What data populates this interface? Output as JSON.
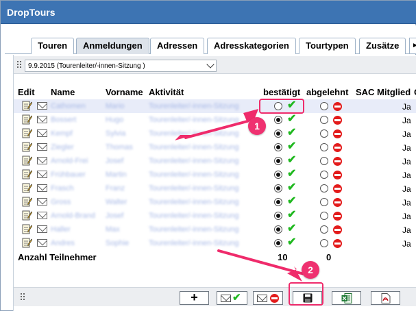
{
  "window": {
    "title": "DropTours"
  },
  "tabs": [
    {
      "label": "Touren"
    },
    {
      "label": "Anmeldungen",
      "active": true
    },
    {
      "label": "Adressen"
    },
    {
      "label": "Adresskategorien"
    },
    {
      "label": "Tourtypen"
    },
    {
      "label": "Zusätze"
    }
  ],
  "filter": {
    "selected": "9.9.2015 (Tourenleiter/-innen-Sitzung )"
  },
  "columns": {
    "edit": "Edit",
    "name": "Name",
    "vorname": "Vorname",
    "aktivitaet": "Aktivität",
    "bestaetigt": "bestätigt",
    "abgelehnt": "abgelehnt",
    "sac": "SAC Mitglied",
    "extra": "G"
  },
  "rows": [
    {
      "name": "Cathomen",
      "vorname": "Mario",
      "aktivitaet": "Tourenleiter/-innen-Sitzung",
      "bestaetigt": false,
      "sac": "Ja",
      "selected": true
    },
    {
      "name": "Bossert",
      "vorname": "Hugo",
      "aktivitaet": "Tourenleiter/-innen-Sitzung",
      "bestaetigt": true,
      "sac": "Ja"
    },
    {
      "name": "Kempf",
      "vorname": "Sylvia",
      "aktivitaet": "Tourenleiter/-innen-Sitzung",
      "bestaetigt": true,
      "sac": "Ja"
    },
    {
      "name": "Ziegler",
      "vorname": "Thomas",
      "aktivitaet": "Tourenleiter/-innen-Sitzung",
      "bestaetigt": true,
      "sac": "Ja"
    },
    {
      "name": "Arnold-Frei",
      "vorname": "Josef",
      "aktivitaet": "Tourenleiter/-innen-Sitzung",
      "bestaetigt": true,
      "sac": "Ja"
    },
    {
      "name": "Frühbauer",
      "vorname": "Martin",
      "aktivitaet": "Tourenleiter/-innen-Sitzung",
      "bestaetigt": true,
      "sac": "Ja"
    },
    {
      "name": "Frasch",
      "vorname": "Franz",
      "aktivitaet": "Tourenleiter/-innen-Sitzung",
      "bestaetigt": true,
      "sac": "Ja"
    },
    {
      "name": "Gross",
      "vorname": "Walter",
      "aktivitaet": "Tourenleiter/-innen-Sitzung",
      "bestaetigt": true,
      "sac": "Ja"
    },
    {
      "name": "Arnold-Brand",
      "vorname": "Josef",
      "aktivitaet": "Tourenleiter/-innen-Sitzung",
      "bestaetigt": true,
      "sac": "Ja"
    },
    {
      "name": "Haller",
      "vorname": "Max",
      "aktivitaet": "Tourenleiter/-innen-Sitzung",
      "bestaetigt": true,
      "sac": "Ja"
    },
    {
      "name": "Andres",
      "vorname": "Sophie",
      "aktivitaet": "Tourenleiter/-innen-Sitzung",
      "bestaetigt": true,
      "sac": "Ja"
    }
  ],
  "summary": {
    "label": "Anzahl Teilnehmer",
    "bestaetigt_count": "10",
    "abgelehnt_count": "0"
  },
  "toolbar": {
    "add_label": "+",
    "buttons": [
      "add-icon",
      "mail-confirm-icon",
      "mail-reject-icon",
      "save-icon",
      "excel-export-icon",
      "pdf-export-icon"
    ]
  },
  "annotations": {
    "callout_1": "1",
    "callout_2": "2"
  },
  "colors": {
    "titlebar": "#3d74b3",
    "accent": "#ef2b6b",
    "check": "#1fb81f",
    "reject": "#e31b1b"
  }
}
